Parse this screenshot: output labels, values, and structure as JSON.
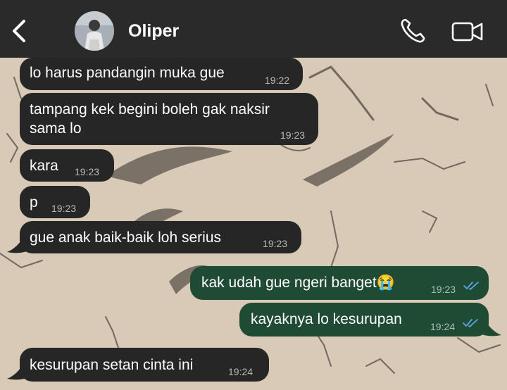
{
  "header": {
    "contact_name": "Oliper"
  },
  "messages": [
    {
      "direction": "in",
      "text": "lo harus pandangin muka gue",
      "time": "19:22"
    },
    {
      "direction": "in",
      "text": "tampang kek begini boleh gak naksir\nsama lo",
      "time": "19:23"
    },
    {
      "direction": "in",
      "text": "kara",
      "time": "19:23"
    },
    {
      "direction": "in",
      "text": "p",
      "time": "19:23"
    },
    {
      "direction": "in",
      "text": "gue anak baik-baik loh serius",
      "time": "19:23"
    },
    {
      "direction": "out",
      "text": "kak udah gue ngeri banget😭",
      "time": "19:23",
      "status": "read"
    },
    {
      "direction": "out",
      "text": "kayaknya lo kesurupan",
      "time": "19:24",
      "status": "read"
    },
    {
      "direction": "in",
      "text": "kesurupan setan cinta ini",
      "time": "19:24"
    }
  ],
  "colors": {
    "header_bg": "#2a2a2a",
    "incoming_bubble": "#262626",
    "outgoing_bubble": "#1f4a34",
    "read_ticks": "#5aa7e0",
    "wallpaper": "#d7c9b4"
  },
  "icons": [
    "back-chevron-icon",
    "phone-icon",
    "video-camera-icon",
    "double-check-icon"
  ]
}
